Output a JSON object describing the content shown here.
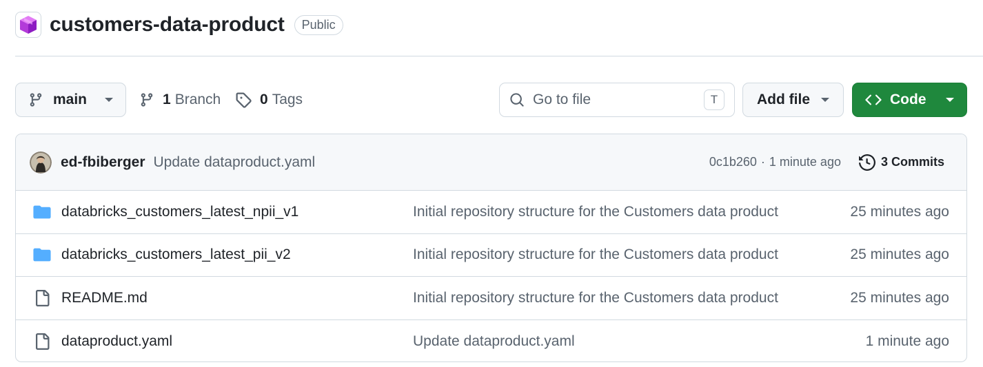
{
  "repo": {
    "name": "customers-data-product",
    "visibility": "Public"
  },
  "toolbar": {
    "branch": "main",
    "branches_count": "1",
    "branches_label": "Branch",
    "tags_count": "0",
    "tags_label": "Tags",
    "search_placeholder": "Go to file",
    "search_shortcut": "T",
    "add_file_label": "Add file",
    "code_label": "Code"
  },
  "latest_commit": {
    "author": "ed-fbiberger",
    "message": "Update dataproduct.yaml",
    "sha": "0c1b260",
    "separator": "·",
    "time": "1 minute ago",
    "commits_label": "3 Commits"
  },
  "files": [
    {
      "type": "folder",
      "name": "databricks_customers_latest_npii_v1",
      "message": "Initial repository structure for the Customers data product",
      "time": "25 minutes ago"
    },
    {
      "type": "folder",
      "name": "databricks_customers_latest_pii_v2",
      "message": "Initial repository structure for the Customers data product",
      "time": "25 minutes ago"
    },
    {
      "type": "file",
      "name": "README.md",
      "message": "Initial repository structure for the Customers data product",
      "time": "25 minutes ago"
    },
    {
      "type": "file",
      "name": "dataproduct.yaml",
      "message": "Update dataproduct.yaml",
      "time": "1 minute ago"
    }
  ],
  "colors": {
    "primary_button": "#1f883d",
    "folder_icon": "#54aeff",
    "border": "#d1d9e0",
    "muted_text": "#59636e"
  }
}
